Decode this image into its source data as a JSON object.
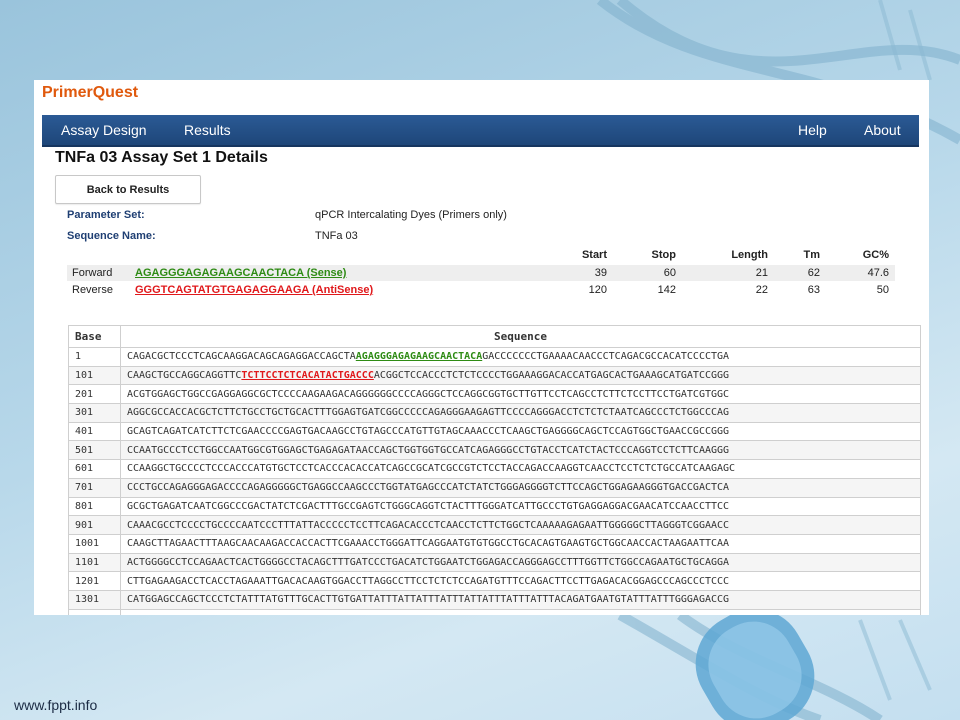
{
  "app": {
    "brand": "PrimerQuest"
  },
  "nav": {
    "left": [
      "Assay Design",
      "Results"
    ],
    "right": [
      "Help",
      "About"
    ]
  },
  "page_title": "TNFa 03 Assay Set 1 Details",
  "back_button": "Back to Results",
  "params": [
    {
      "label": "Parameter Set:",
      "value": "qPCR Intercalating Dyes (Primers only)"
    },
    {
      "label": "Sequence Name:",
      "value": "TNFa 03"
    }
  ],
  "oligo_headers": [
    "Start",
    "Stop",
    "Length",
    "Tm",
    "GC%"
  ],
  "oligos": [
    {
      "type": "Forward",
      "sequence": "AGAGGGAGAGAAGCAACTACA (Sense)",
      "start": "39",
      "stop": "60",
      "length": "21",
      "tm": "62",
      "gc": "47.6"
    },
    {
      "type": "Reverse",
      "sequence": "GGGTCAGTATGTGAGAGGAAGA (AntiSense)",
      "start": "120",
      "stop": "142",
      "length": "22",
      "tm": "63",
      "gc": "50"
    }
  ],
  "seq_table": {
    "headers": [
      "Base",
      "Sequence"
    ],
    "rows": [
      {
        "base": "1",
        "pre": "CAGACGCTCCCTCAGCAAGGACAGCAGAGGACCAGCTA",
        "fwd": "AGAGGGAGAGAAGCAACTACA",
        "post": "GACCCCCCCTGAAAACAACCCTCAGACGCCACATCCCCTGA"
      },
      {
        "base": "101",
        "pre": "CAAGCTGCCAGGCAGGTTC",
        "rev": "TCTTCCTCTCACATACTGACCC",
        "post": "ACGGCTCCACCCTCTCTCCCCTGGAAAGGACACCATGAGCACTGAAAGCATGATCCGGG"
      },
      {
        "base": "201",
        "pre": "ACGTGGAGCTGGCCGAGGAGGCGCTCCCCAAGAAGACAGGGGGGCCCCAGGGCTCCAGGCGGTGCTTGTTCCTCAGCCTCTTCTCCTTCCTGATCGTGGC"
      },
      {
        "base": "301",
        "pre": "AGGCGCCACCACGCTCTTCTGCCTGCTGCACTTTGGAGTGATCGGCCCCCAGAGGGAAGAGTTCCCCAGGGACCTCTCTCTAATCAGCCCTCTGGCCCAG"
      },
      {
        "base": "401",
        "pre": "GCAGTCAGATCATCTTCTCGAACCCCGAGTGACAAGCCTGTAGCCCATGTTGTAGCAAACCCTCAAGCTGAGGGGCAGCTCCAGTGGCTGAACCGCCGGG"
      },
      {
        "base": "501",
        "pre": "CCAATGCCCTCCTGGCCAATGGCGTGGAGCTGAGAGATAACCAGCTGGTGGTGCCATCAGAGGGCCTGTACCTCATCTACTCCCAGGTCCTCTTCAAGGG"
      },
      {
        "base": "601",
        "pre": "CCAAGGCTGCCCCTCCCACCCATGTGCTCCTCACCCACACCATCAGCCGCATCGCCGTCTCCTACCAGACCAAGGTCAACCTCCTCTCTGCCATCAAGAGC"
      },
      {
        "base": "701",
        "pre": "CCCTGCCAGAGGGAGACCCCAGAGGGGGCTGAGGCCAAGCCCTGGTATGAGCCCATCTATCTGGGAGGGGTCTTCCAGCTGGAGAAGGGTGACCGACTCA"
      },
      {
        "base": "801",
        "pre": "GCGCTGAGATCAATCGGCCCGACTATCTCGACTTTGCCGAGTCTGGGCAGGTCTACTTTGGGATCATTGCCCTGTGAGGAGGACGAACATCCAACCTTCC"
      },
      {
        "base": "901",
        "pre": "CAAACGCCTCCCCTGCCCCAATCCCTTTATTACCCCCTCCTTCAGACACCCTCAACCTCTTCTGGCTCAAAAAGAGAATTGGGGGCTTAGGGTCGGAACC"
      },
      {
        "base": "1001",
        "pre": "CAAGCTTAGAACTTTAAGCAACAAGACCACCACTTCGAAACCTGGGATTCAGGAATGTGTGGCCTGCACAGTGAAGTGCTGGCAACCACTAAGAATTCAA"
      },
      {
        "base": "1101",
        "pre": "ACTGGGGCCTCCAGAACTCACTGGGGCCTACAGCTTTGATCCCTGACATCTGGAATCTGGAGACCAGGGAGCCTTTGGTTCTGGCCAGAATGCTGCAGGA"
      },
      {
        "base": "1201",
        "pre": "CTTGAGAAGACCTCACCTAGAAATTGACACAAGTGGACCTTAGGCCTTCCTCTCTCCAGATGTTTCCAGACTTCCTTGAGACACGGAGCCCAGCCCTCCC"
      },
      {
        "base": "1301",
        "pre": "CATGGAGCCAGCTCCCTCTATTTATGTTTGCACTTGTGATTATTTATTATTTATTTATTATTTATTTATTTACAGATGAATGTATTTATTTGGGAGACCG"
      },
      {
        "base": "",
        "pre": ""
      }
    ]
  },
  "footer": "www.fppt.info",
  "colors": {
    "brand": "#e0590d",
    "nav": "#1e4679",
    "forward": "#2e8b14",
    "reverse": "#e0181b"
  }
}
